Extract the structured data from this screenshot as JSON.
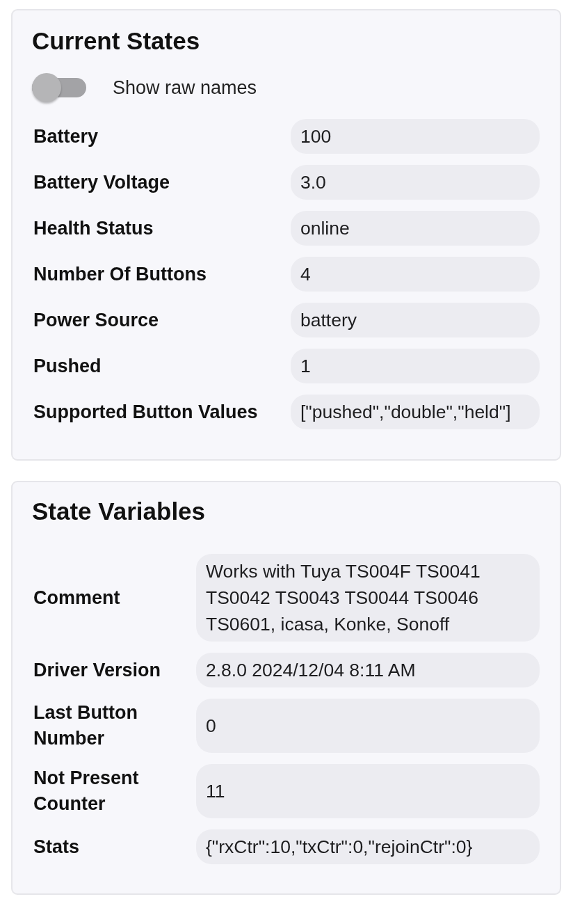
{
  "sections": [
    {
      "title": "Current States",
      "toggle": {
        "label": "Show raw names",
        "on": false
      },
      "rows": [
        {
          "label": "Battery",
          "value": "100"
        },
        {
          "label": "Battery Voltage",
          "value": "3.0"
        },
        {
          "label": "Health Status",
          "value": "online"
        },
        {
          "label": "Number Of Buttons",
          "value": "4"
        },
        {
          "label": "Power Source",
          "value": "battery"
        },
        {
          "label": "Pushed",
          "value": "1"
        },
        {
          "label": "Supported Button Values",
          "value": "[\"pushed\",\"double\",\"held\"]"
        }
      ]
    },
    {
      "title": "State Variables",
      "rows": [
        {
          "label": "Comment",
          "value": "Works with Tuya TS004F TS0041 TS0042 TS0043 TS0044 TS0046 TS0601, icasa, Konke, Sonoff"
        },
        {
          "label": "Driver Version",
          "value": "2.8.0 2024/12/04 8:11 AM"
        },
        {
          "label": "Last Button Number",
          "value": "0"
        },
        {
          "label": "Not Present Counter",
          "value": "11"
        },
        {
          "label": "Stats",
          "value": "{\"rxCtr\":10,\"txCtr\":0,\"rejoinCtr\":0}"
        }
      ]
    }
  ]
}
